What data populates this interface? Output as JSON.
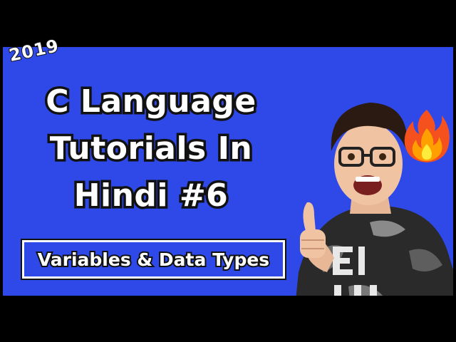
{
  "thumbnail": {
    "year": "2019",
    "title_lines": [
      "C Language",
      "Tutorials In",
      "Hindi #6"
    ],
    "subtitle": "Variables & Data Types",
    "icons": {
      "fire": "fire-icon",
      "thumbs_up": "thumbs-up-icon"
    },
    "colors": {
      "background": "#2f49e8",
      "letterbox": "#000000",
      "text": "#ffffff",
      "outline": "#111111"
    }
  }
}
